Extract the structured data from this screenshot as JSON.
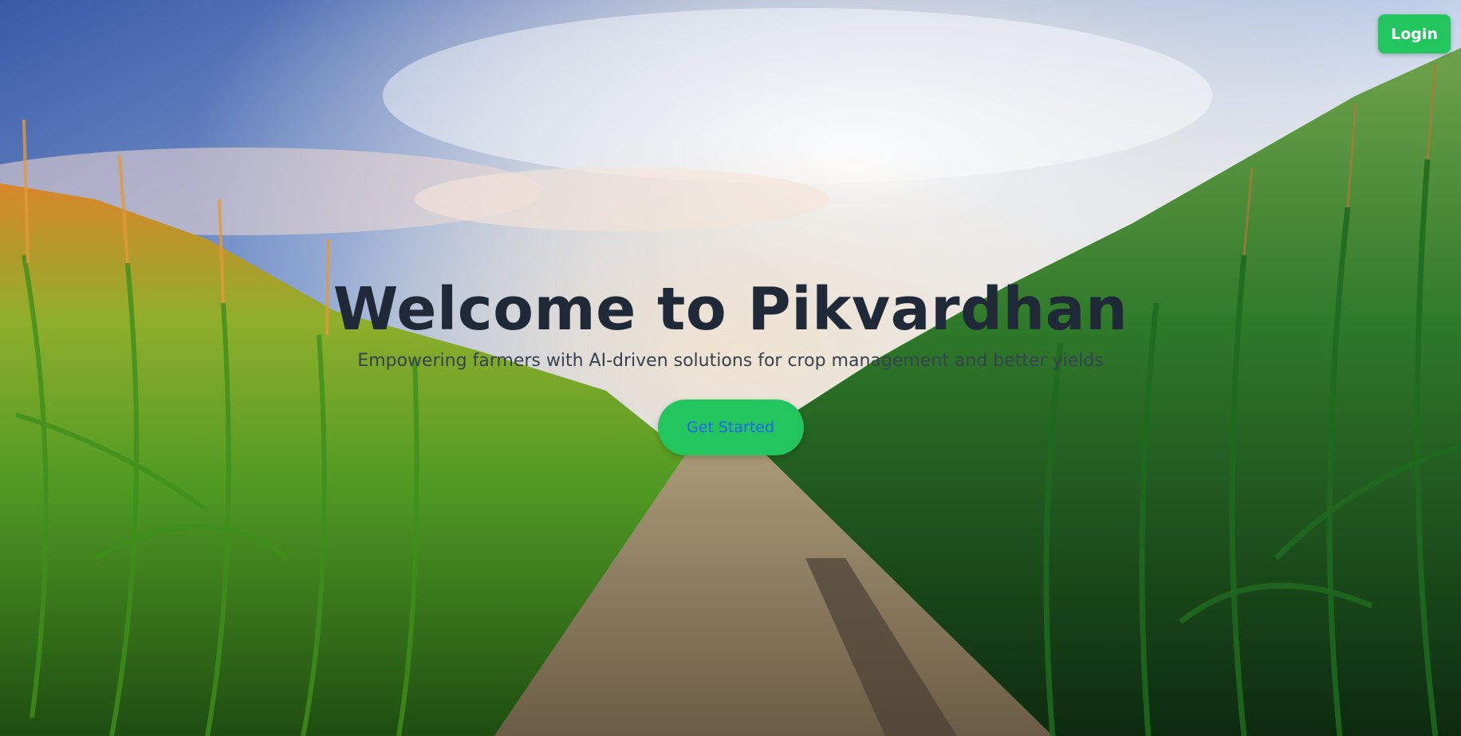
{
  "nav": {
    "login_label": "Login"
  },
  "hero": {
    "title": "Welcome to Pikvardhan",
    "subtitle": "Empowering farmers with AI-driven solutions for crop management and better yields",
    "cta_label": "Get Started",
    "background": "cornfield-dirt-path-photo"
  },
  "colors": {
    "accent": "#22c55e",
    "title": "#1f2937",
    "subtitle": "#374151",
    "cta_text": "#2563eb"
  }
}
